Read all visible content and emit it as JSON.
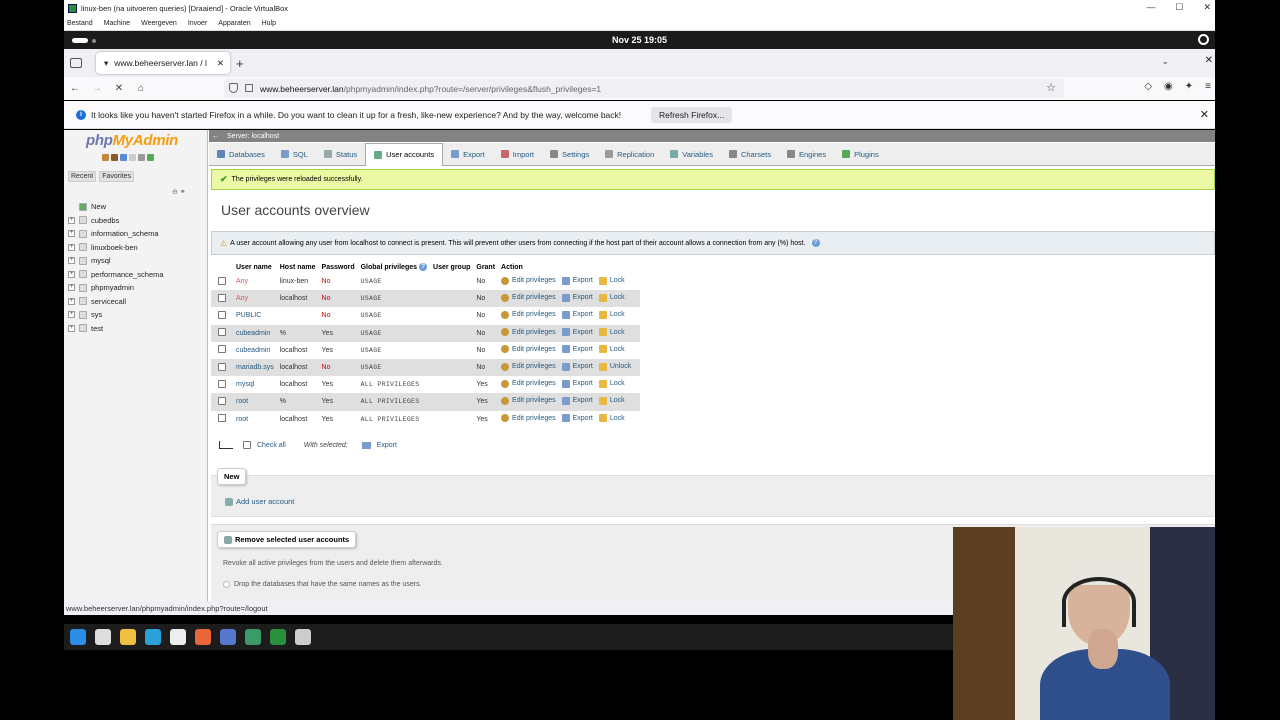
{
  "vbox": {
    "title": "linux-ben (na uitvoeren queries) [Draaiend] - Oracle VirtualBox",
    "menu": [
      "Bestand",
      "Machine",
      "Weergeven",
      "Invoer",
      "Apparaten",
      "Hulp"
    ]
  },
  "gnome": {
    "clock": "Nov 25  19:05"
  },
  "firefox": {
    "tab_title": "www.beheerserver.lan / l",
    "url_host": "www.beheerserver.lan",
    "url_path": "/phpmyadmin/index.php?route=/server/privileges&flush_privileges=1",
    "notice_text": "It looks like you haven't started Firefox in a while. Do you want to clean it up for a fresh, like-new experience? And by the way, welcome back!",
    "refresh_button": "Refresh Firefox...",
    "status_url": "www.beheerserver.lan/phpmyadmin/index.php?route=/logout"
  },
  "pma": {
    "logo_php": "php",
    "logo_myadmin": "MyAdmin",
    "left_tabs": {
      "recent": "Recent",
      "favorites": "Favorites"
    },
    "tree": {
      "new": "New",
      "databases": [
        "cubedbs",
        "information_schema",
        "linuxboek-ben",
        "mysql",
        "performance_schema",
        "phpmyadmin",
        "servicecall",
        "sys",
        "test"
      ]
    },
    "breadcrumb": "Server: localhost",
    "menu": [
      {
        "label": "Databases",
        "icon": "database-icon",
        "color": "#5b87b7"
      },
      {
        "label": "SQL",
        "icon": "sql-icon",
        "color": "#7a9ccc"
      },
      {
        "label": "Status",
        "icon": "status-icon",
        "color": "#9aa"
      },
      {
        "label": "User accounts",
        "icon": "users-icon",
        "color": "#6a8"
      },
      {
        "label": "Export",
        "icon": "export-icon",
        "color": "#7a9ccc"
      },
      {
        "label": "Import",
        "icon": "import-icon",
        "color": "#c66"
      },
      {
        "label": "Settings",
        "icon": "settings-icon",
        "color": "#888"
      },
      {
        "label": "Replication",
        "icon": "replication-icon",
        "color": "#999"
      },
      {
        "label": "Variables",
        "icon": "variables-icon",
        "color": "#7aa"
      },
      {
        "label": "Charsets",
        "icon": "charsets-icon",
        "color": "#888"
      },
      {
        "label": "Engines",
        "icon": "engines-icon",
        "color": "#888"
      },
      {
        "label": "Plugins",
        "icon": "plugins-icon",
        "color": "#5a5"
      }
    ],
    "success_message": "The privileges were reloaded successfully.",
    "page_title": "User accounts overview",
    "warning_message": "A user account allowing any user from localhost to connect is present. This will prevent other users from connecting if the host part of their account allows a connection from any (%) host.",
    "columns": [
      "User name",
      "Host name",
      "Password",
      "Global privileges",
      "User group",
      "Grant",
      "Action"
    ],
    "users": [
      {
        "user": "Any",
        "host": "linux-ben",
        "password": "No",
        "privileges": "USAGE",
        "group": "",
        "grant": "No",
        "lock": "Lock",
        "any": true
      },
      {
        "user": "Any",
        "host": "localhost",
        "password": "No",
        "privileges": "USAGE",
        "group": "",
        "grant": "No",
        "lock": "Lock",
        "any": true
      },
      {
        "user": "PUBLIC",
        "host": "",
        "password": "No",
        "privileges": "USAGE",
        "group": "",
        "grant": "No",
        "lock": "Lock",
        "any": false
      },
      {
        "user": "cubeadmin",
        "host": "%",
        "password": "Yes",
        "privileges": "USAGE",
        "group": "",
        "grant": "No",
        "lock": "Lock",
        "any": false
      },
      {
        "user": "cubeadmin",
        "host": "localhost",
        "password": "Yes",
        "privileges": "USAGE",
        "group": "",
        "grant": "No",
        "lock": "Lock",
        "any": false
      },
      {
        "user": "mariadb.sys",
        "host": "localhost",
        "password": "No",
        "privileges": "USAGE",
        "group": "",
        "grant": "No",
        "lock": "Unlock",
        "any": false
      },
      {
        "user": "mysql",
        "host": "localhost",
        "password": "Yes",
        "privileges": "ALL PRIVILEGES",
        "group": "",
        "grant": "Yes",
        "lock": "Lock",
        "any": false
      },
      {
        "user": "root",
        "host": "%",
        "password": "Yes",
        "privileges": "ALL PRIVILEGES",
        "group": "",
        "grant": "Yes",
        "lock": "Lock",
        "any": false
      },
      {
        "user": "root",
        "host": "localhost",
        "password": "Yes",
        "privileges": "ALL PRIVILEGES",
        "group": "",
        "grant": "Yes",
        "lock": "Lock",
        "any": false
      }
    ],
    "action_labels": {
      "edit": "Edit privileges",
      "export": "Export"
    },
    "bulk": {
      "check_all": "Check all",
      "with_selected": "With selected:",
      "export": "Export"
    },
    "new_legend": "New",
    "add_user": "Add user account",
    "remove_legend": "Remove selected user accounts",
    "revoke_text": "Revoke all active privileges from the users and delete them afterwards.",
    "drop_text": "Drop the databases that have the same names as the users."
  },
  "taskbar_icons": [
    {
      "name": "windows-start-icon",
      "color": "#2b8de8"
    },
    {
      "name": "search-icon",
      "color": "#ddd"
    },
    {
      "name": "file-explorer-icon",
      "color": "#f0c040"
    },
    {
      "name": "edge-icon",
      "color": "#2aa0d8"
    },
    {
      "name": "store-icon",
      "color": "#eee"
    },
    {
      "name": "firefox-icon",
      "color": "#e8663a"
    },
    {
      "name": "save-icon",
      "color": "#5577cc"
    },
    {
      "name": "vs-icon",
      "color": "#3a9a6a"
    },
    {
      "name": "virtualbox-icon",
      "color": "#2a8f3c"
    },
    {
      "name": "obs-icon",
      "color": "#ccc"
    }
  ]
}
